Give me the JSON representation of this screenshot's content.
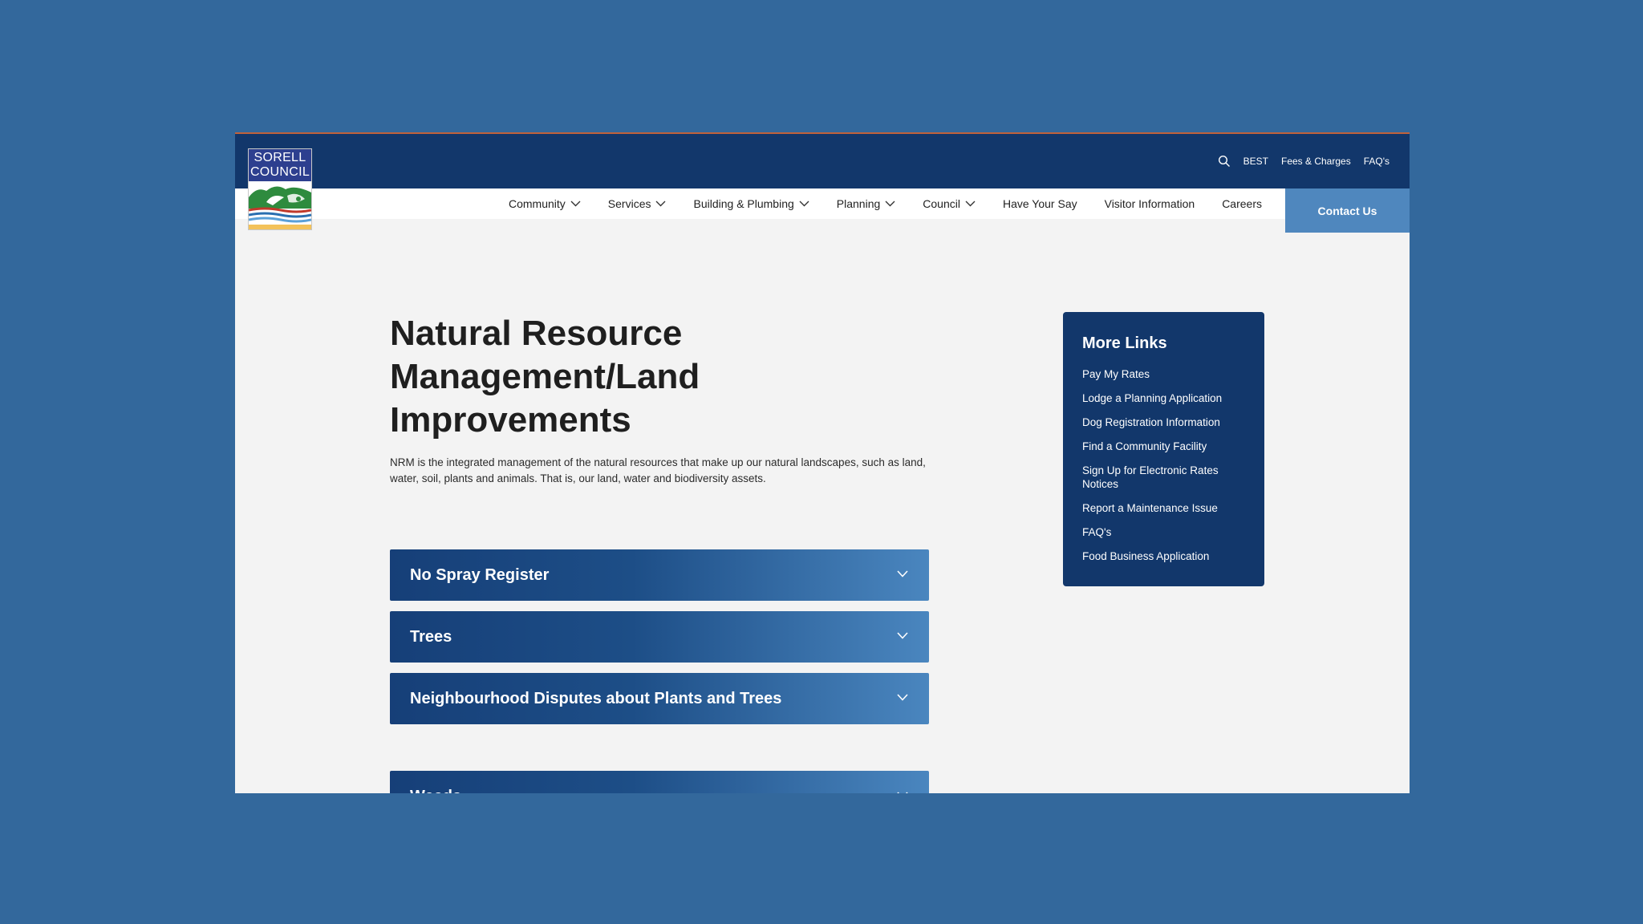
{
  "utility": {
    "items": [
      "BEST",
      "Fees & Charges",
      "FAQ's"
    ]
  },
  "logo": {
    "line1": "SORELL",
    "line2": "COUNCIL"
  },
  "nav": {
    "items": [
      {
        "label": "Community",
        "dropdown": true
      },
      {
        "label": "Services",
        "dropdown": true
      },
      {
        "label": "Building & Plumbing",
        "dropdown": true
      },
      {
        "label": "Planning",
        "dropdown": true
      },
      {
        "label": "Council",
        "dropdown": true
      },
      {
        "label": "Have Your Say",
        "dropdown": false
      },
      {
        "label": "Visitor Information",
        "dropdown": false
      },
      {
        "label": "Careers",
        "dropdown": false
      }
    ],
    "contact_label": "Contact Us"
  },
  "page": {
    "title": "Natural Resource Management/Land Improvements",
    "intro": "NRM is the integrated management of the natural resources that make up our natural landscapes, such as land, water, soil, plants and animals. That is, our land, water and biodiversity assets."
  },
  "accordions": [
    {
      "label": "No Spray Register"
    },
    {
      "label": "Trees"
    },
    {
      "label": "Neighbourhood Disputes about Plants and Trees"
    },
    {
      "label": "Weeds"
    }
  ],
  "more_links": {
    "title": "More Links",
    "items": [
      "Pay My Rates",
      "Lodge a Planning Application",
      "Dog Registration Information",
      "Find a Community Facility",
      "Sign Up for Electronic Rates Notices",
      "Report a Maintenance Issue",
      "FAQ's",
      "Food Business Application"
    ]
  },
  "colors": {
    "background": "#33689c",
    "header_navy": "#12376b",
    "accent_blue": "#4f87be",
    "page_bg": "#f3f3f3"
  },
  "icons": {
    "search": "search-icon",
    "nav_dropdown": "chevron-down-icon",
    "accordion": "chevron-down-icon"
  }
}
